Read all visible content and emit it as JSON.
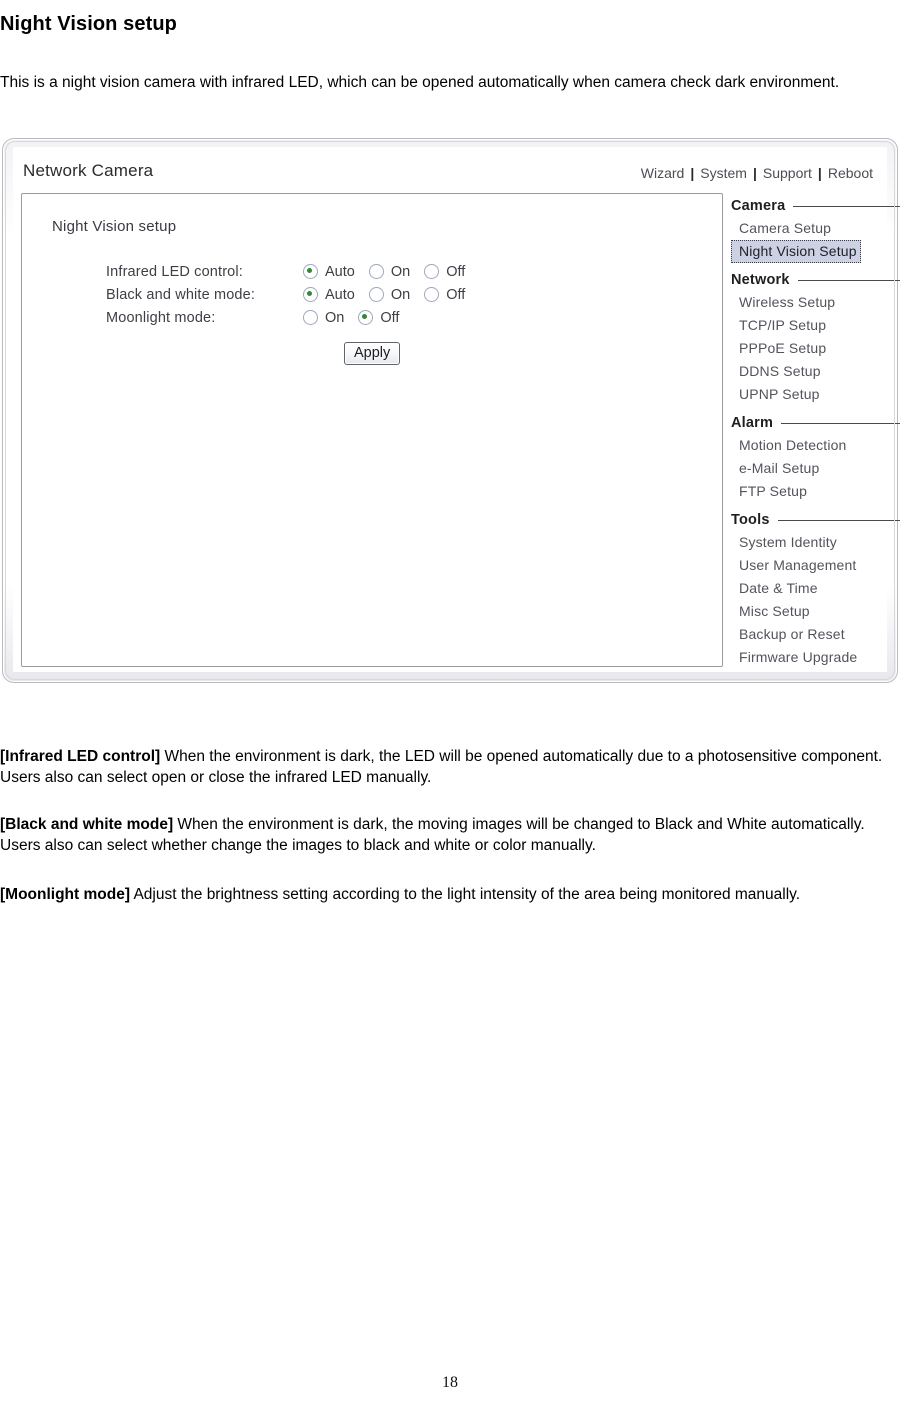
{
  "document": {
    "title": "Night Vision setup",
    "intro": "This is a night vision camera with infrared LED, which can be opened automatically when camera check dark environment.",
    "page_number": "18"
  },
  "screenshot": {
    "brand": "Network Camera",
    "nav_links": [
      "Wizard",
      "System",
      "Support",
      "Reboot"
    ],
    "nav_separator": "|",
    "panel": {
      "title": "Night Vision setup",
      "apply_label": "Apply",
      "settings": [
        {
          "label": "Infrared LED control:",
          "options": [
            {
              "label": "Auto",
              "selected": true
            },
            {
              "label": "On",
              "selected": false
            },
            {
              "label": "Off",
              "selected": false
            }
          ]
        },
        {
          "label": "Black and white mode:",
          "options": [
            {
              "label": "Auto",
              "selected": true
            },
            {
              "label": "On",
              "selected": false
            },
            {
              "label": "Off",
              "selected": false
            }
          ]
        },
        {
          "label": "Moonlight mode:",
          "options": [
            {
              "label": "On",
              "selected": false
            },
            {
              "label": "Off",
              "selected": true
            }
          ]
        }
      ]
    },
    "sidebar": [
      {
        "section": "Camera",
        "items": [
          {
            "label": "Camera Setup",
            "active": false
          },
          {
            "label": "Night Vision Setup",
            "active": true
          }
        ]
      },
      {
        "section": "Network",
        "items": [
          {
            "label": "Wireless Setup",
            "active": false
          },
          {
            "label": "TCP/IP Setup",
            "active": false
          },
          {
            "label": "PPPoE Setup",
            "active": false
          },
          {
            "label": "DDNS Setup",
            "active": false
          },
          {
            "label": "UPNP Setup",
            "active": false
          }
        ]
      },
      {
        "section": "Alarm",
        "items": [
          {
            "label": "Motion Detection",
            "active": false
          },
          {
            "label": "e-Mail Setup",
            "active": false
          },
          {
            "label": "FTP Setup",
            "active": false
          }
        ]
      },
      {
        "section": "Tools",
        "items": [
          {
            "label": "System Identity",
            "active": false
          },
          {
            "label": "User Management",
            "active": false
          },
          {
            "label": "Date & Time",
            "active": false
          },
          {
            "label": "Misc Setup",
            "active": false
          },
          {
            "label": "Backup or Reset",
            "active": false
          },
          {
            "label": "Firmware Upgrade",
            "active": false
          }
        ]
      }
    ]
  },
  "descriptions": [
    {
      "term": "[Infrared LED control]",
      "text": " When the environment is dark, the LED will be opened automatically due to a photosensitive component. Users also can select open or close the infrared LED manually."
    },
    {
      "term": "[Black and white mode]",
      "text": " When the environment is dark, the moving images will be changed to Black and White automatically. Users also can select whether change the images to black and white or color manually."
    },
    {
      "term": "[Moonlight mode]",
      "text": " Adjust the brightness setting according to the light intensity of the area being monitored manually."
    }
  ],
  "colors": {
    "accent_selected_radio": "#2e8b33",
    "active_menu_bg": "#ccd2e4",
    "frame_border": "#b9b9c2"
  }
}
